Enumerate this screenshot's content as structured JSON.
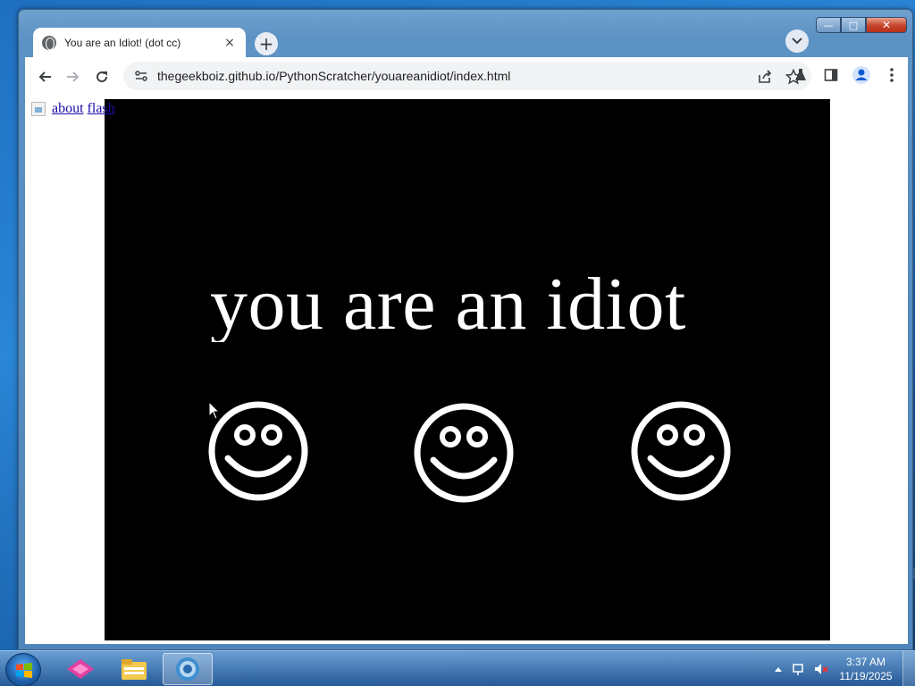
{
  "browser": {
    "tab_title": "You are an Idiot! (dot cc)",
    "tab_close": "×",
    "new_tab": "+",
    "url": "thegeekboiz.github.io/PythonScratcher/youareanidiot/index.html"
  },
  "page": {
    "links": [
      "about",
      "flash"
    ],
    "headline": "you are an idiot"
  },
  "taskbar": {
    "time": "3:37 AM",
    "date": "11/19/2025"
  },
  "colors": {
    "stage_background": "#000000",
    "headline_color": "#ffffff",
    "link_color": "#1a0dab"
  },
  "icons": [
    "globe-icon",
    "close-icon",
    "plus-icon",
    "chevron-down-icon",
    "back-arrow-icon",
    "forward-arrow-icon",
    "reload-icon",
    "site-info-icon",
    "share-icon",
    "star-icon",
    "labs-icon",
    "sidepanel-icon",
    "profile-icon",
    "menu-dots-icon",
    "smiley-icon",
    "windows-start-icon",
    "explorer-icon",
    "browser-icon",
    "volume-muted-icon"
  ]
}
